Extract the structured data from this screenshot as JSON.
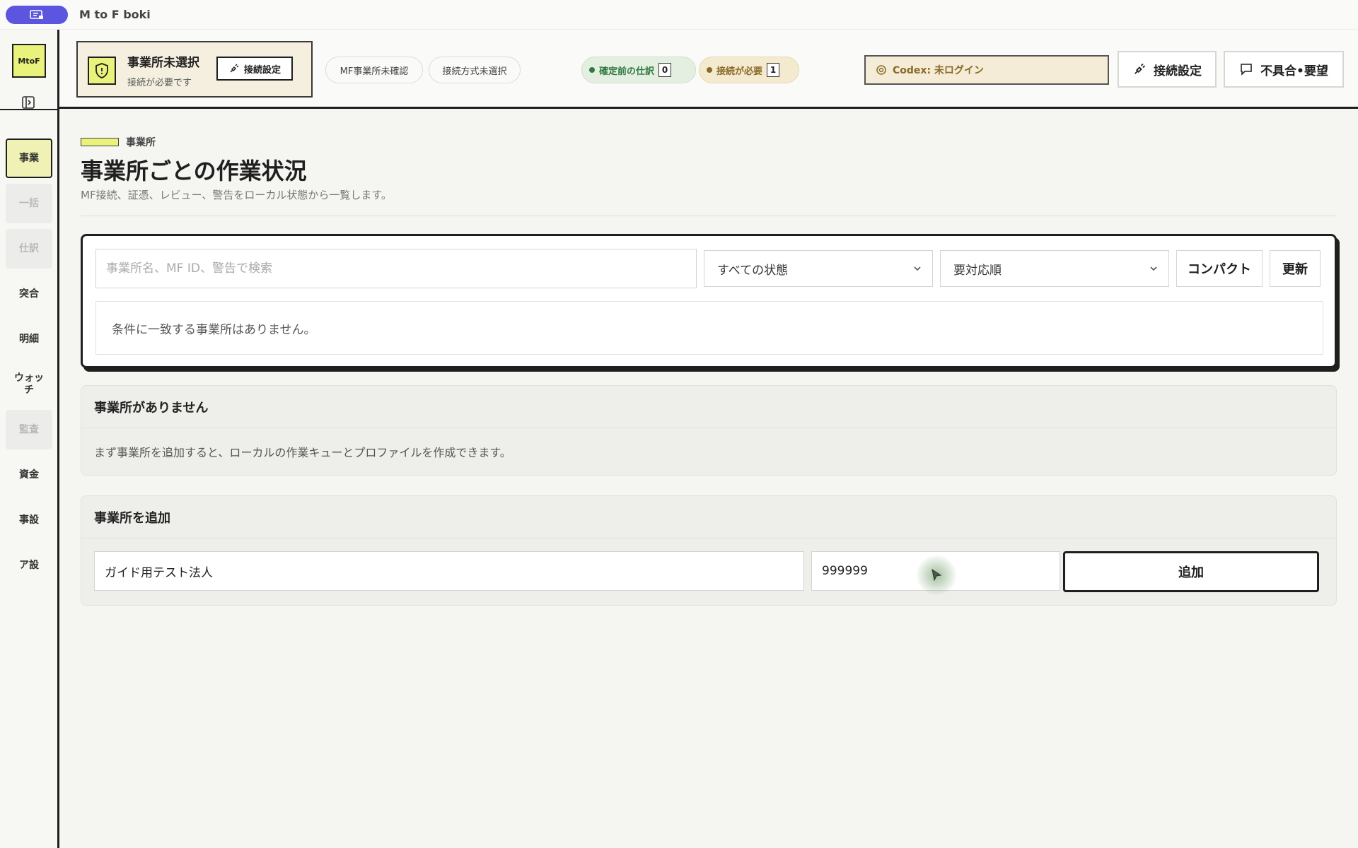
{
  "window": {
    "title": "M to F boki"
  },
  "sidebar": {
    "logo": "MtoF",
    "items": [
      {
        "label": "事業",
        "state": "active"
      },
      {
        "label": "一括",
        "state": "disabled"
      },
      {
        "label": "仕訳",
        "state": "disabled"
      },
      {
        "label": "突合",
        "state": "normal"
      },
      {
        "label": "明細",
        "state": "normal"
      },
      {
        "label": "ウォッチ",
        "state": "normal"
      },
      {
        "label": "監査",
        "state": "disabled"
      },
      {
        "label": "資金",
        "state": "normal"
      },
      {
        "label": "事設",
        "state": "normal"
      },
      {
        "label": "ア設",
        "state": "normal"
      }
    ]
  },
  "header": {
    "office_title": "事業所未選択",
    "office_sub": "接続が必要です",
    "card_connect_label": "接続設定",
    "chip_mf": "MF事業所未確認",
    "chip_method": "接続方式未選択",
    "status_confirm": {
      "label": "確定前の仕訳",
      "count": "0",
      "color": "#2f7a3f"
    },
    "status_needed": {
      "label": "接続が必要",
      "count": "1",
      "color": "#8a6a2a"
    },
    "codex": "Codex: 未ログイン",
    "connect_button": "接続設定",
    "feedback_button": "不具合•要望"
  },
  "main": {
    "section_tag": "事業所",
    "title": "事業所ごとの作業状況",
    "description": "MF接続、証憑、レビュー、警告をローカル状態から一覧します。",
    "search_placeholder": "事業所名、MF ID、警告で検索",
    "status_select": "すべての状態",
    "sort_select": "要対応順",
    "compact_button": "コンパクト",
    "refresh_button": "更新",
    "empty_result": "条件に一致する事業所はありません。",
    "no_offices_title": "事業所がありません",
    "no_offices_body": "まず事業所を追加すると、ローカルの作業キューとプロファイルを作成できます。",
    "add_title": "事業所を追加",
    "add_name_value": "ガイド用テスト法人",
    "add_id_value": "999999",
    "add_button": "追加"
  },
  "colors": {
    "accent": "#e9f27a",
    "brand_pill": "#5b55e0",
    "border": "#1f1f1f"
  }
}
